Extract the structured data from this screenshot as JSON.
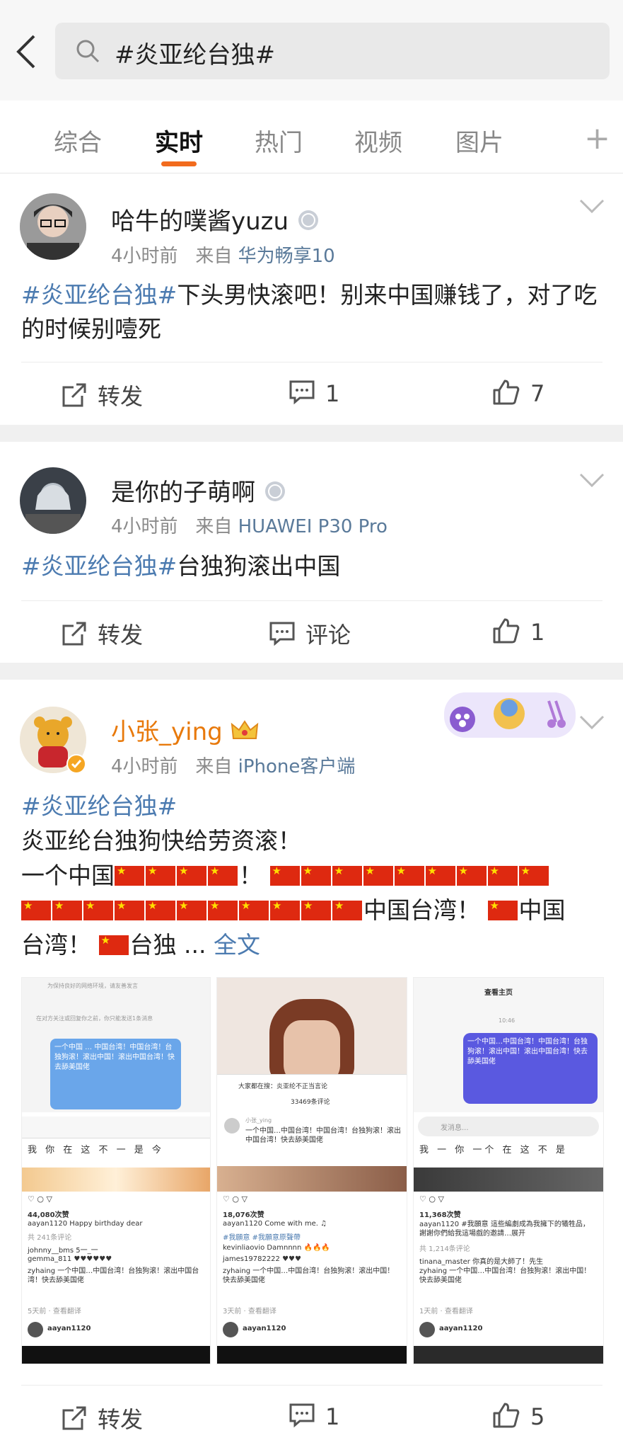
{
  "search": {
    "query": "#炎亚纶台独#"
  },
  "tabs": [
    {
      "label": "综合"
    },
    {
      "label": "实时"
    },
    {
      "label": "热门"
    },
    {
      "label": "视频"
    },
    {
      "label": "图片"
    }
  ],
  "tab_plus": "+",
  "posts": [
    {
      "username": "哈牛的噗酱yuzu",
      "time": "4小时前",
      "source_prefix": "来自",
      "source": "华为畅享10",
      "tag": "#炎亚纶台独#",
      "text": "下头男快滚吧！别来中国赚钱了，对了吃的时候别噎死",
      "repost_label": "转发",
      "comment_label": "1",
      "like_label": "7"
    },
    {
      "username": "是你的子萌啊",
      "time": "4小时前",
      "source_prefix": "来自",
      "source": "HUAWEI P30 Pro",
      "tag": "#炎亚纶台独#",
      "text": "台独狗滚出中国",
      "repost_label": "转发",
      "comment_label": "评论",
      "like_label": "1"
    },
    {
      "username": "小张_ying",
      "time": "4小时前",
      "source_prefix": "来自",
      "source": "iPhone客户端",
      "tag": "#炎亚纶台独#",
      "line1": "炎亚纶台独狗快给劳资滚！",
      "line2_prefix": "一个中国",
      "line2_mid": "！",
      "line3_text": "中国台湾！",
      "line3_tail": "中国",
      "line4_a": "台湾！",
      "line4_b": "台独 ...",
      "more_label": "全文",
      "repost_label": "转发",
      "comment_label": "1",
      "like_label": "5",
      "images": {
        "img1": {
          "notice1": "为保持良好的网络环境，请友善发言",
          "notice2": "在对方关注或回复你之前，你只能发送1条消息",
          "bubble": "一个中国 … 中国台湾！中国台湾！台独狗滚！滚出中国！滚出中国台湾！快去舔美国佬",
          "keys": "我 你 在 这 不 一 是 今",
          "likes": "44,080次赞",
          "caption": "aayan1120 Happy birthday dear",
          "comments_count": "共 241条评论",
          "c1": "johnny__bms 5一_一",
          "c2": "gemma_811 ♥♥♥♥♥♥",
          "c3": "zyhaing 一个中国…中国台湾！台独狗滚！滚出中国台湾！快去舔美国佬",
          "time": "5天前 · 查看翻译",
          "user": "aayan1120"
        },
        "img2": {
          "overlay_title": "大家都在搜：炎亚纶不正当言论",
          "overlay_count": "33469条评论",
          "cm_user": "小张_ying",
          "cm_text": "一个中国…中国台湾！中国台湾！台独狗滚！滚出中国台湾！快去舔美国佬",
          "likes": "18,076次赞",
          "caption": "aayan1120 Come with me. ♫",
          "tags": "#我願意 #我願意原聲帶",
          "c1": "kevinliaovio Damnnnn 🔥🔥🔥",
          "c2": "james19782222 ♥♥♥",
          "c3": "zyhaing 一个中国…中国台湾！台独狗滚！滚出中国！快去舔美国佬",
          "time": "3天前 · 查看翻译",
          "user": "aayan1120"
        },
        "img3": {
          "header": "查看主页",
          "time_label": "10:46",
          "bubble": "一个中国…中国台湾！中国台湾！台独狗滚！滚出中国！滚出中国台湾！快去舔美国佬",
          "input_placeholder": "发消息...",
          "keys": "我 一 你 一个 在 这 不 是",
          "likes": "11,368次赞",
          "caption": "aayan1120 #我願意 這些編劇成為我擁下的犧牲品，謝謝你們給我這場戲的邀請…展开",
          "comments_count": "共 1,214条评论",
          "c1": "tinana_master 你真的是大師了！先生",
          "c2": "zyhaing 一个中国…中国台湾！台独狗滚！滚出中国！快去舔美国佬",
          "time": "1天前 · 查看翻译",
          "user": "aayan1120"
        }
      }
    }
  ],
  "colors": {
    "accent": "#f26b1d",
    "link": "#4c7bb0",
    "vip": "#e8790b"
  }
}
